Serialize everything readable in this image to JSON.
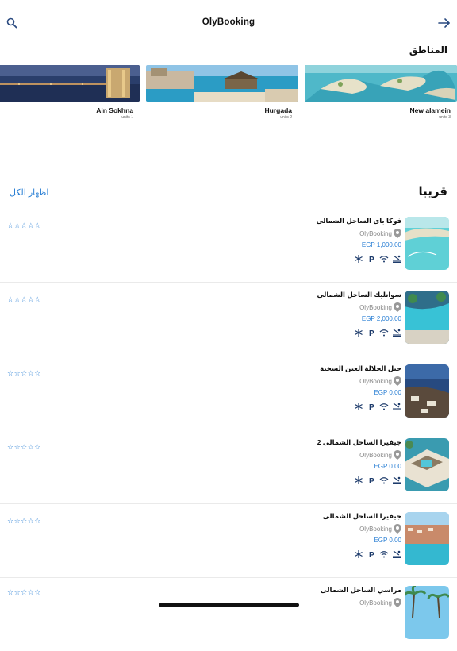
{
  "header": {
    "title": "OlyBooking"
  },
  "regions": {
    "title": "المناطق",
    "items": [
      {
        "name": "New alamein",
        "units": "units 3"
      },
      {
        "name": "Hurgada",
        "units": "units 2"
      },
      {
        "name": "Ain Sokhna",
        "units": "units 1"
      }
    ]
  },
  "nearby": {
    "title": "قريبا",
    "show_all": "اظهار الكل",
    "stars": "☆☆☆☆☆",
    "items": [
      {
        "name": "فوكا باى الساحل الشمالى",
        "location": "OlyBooking",
        "price": "EGP 1,000.00"
      },
      {
        "name": "سوانليك الساحل الشمالى",
        "location": "OlyBooking",
        "price": "EGP 2,000.00"
      },
      {
        "name": "جبل الجلالة العين السخنة",
        "location": "OlyBooking",
        "price": "EGP 0.00"
      },
      {
        "name": "جيفيرا الساحل الشمالى 2",
        "location": "OlyBooking",
        "price": "EGP 0.00"
      },
      {
        "name": "جيفيرا الساحل الشمالى",
        "location": "OlyBooking",
        "price": "EGP 0.00"
      },
      {
        "name": "مراسي الساحل الشمالى",
        "location": "OlyBooking",
        "price": ""
      }
    ]
  },
  "colors": {
    "accent": "#2a7fd4",
    "divider": "#e6e6e6"
  }
}
